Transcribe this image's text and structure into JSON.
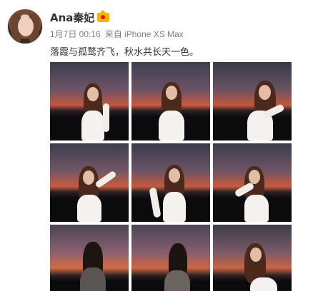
{
  "post": {
    "username": "Ana秦妃",
    "date": "1月7日 00:16",
    "source": "来自 iPhone XS Max",
    "text": "落霞与孤鹜齐飞，秋水共长天一色。"
  },
  "icons": {
    "avatar": "profile-avatar",
    "badge": "vip-crown-icon"
  },
  "colors": {
    "name": "#333333",
    "meta": "#808080",
    "badge": "#f7b500"
  },
  "photos": [
    {
      "id": 1,
      "alt": "photo-1"
    },
    {
      "id": 2,
      "alt": "photo-2"
    },
    {
      "id": 3,
      "alt": "photo-3"
    },
    {
      "id": 4,
      "alt": "photo-4"
    },
    {
      "id": 5,
      "alt": "photo-5"
    },
    {
      "id": 6,
      "alt": "photo-6"
    },
    {
      "id": 7,
      "alt": "photo-7"
    },
    {
      "id": 8,
      "alt": "photo-8"
    },
    {
      "id": 9,
      "alt": "photo-9"
    }
  ]
}
